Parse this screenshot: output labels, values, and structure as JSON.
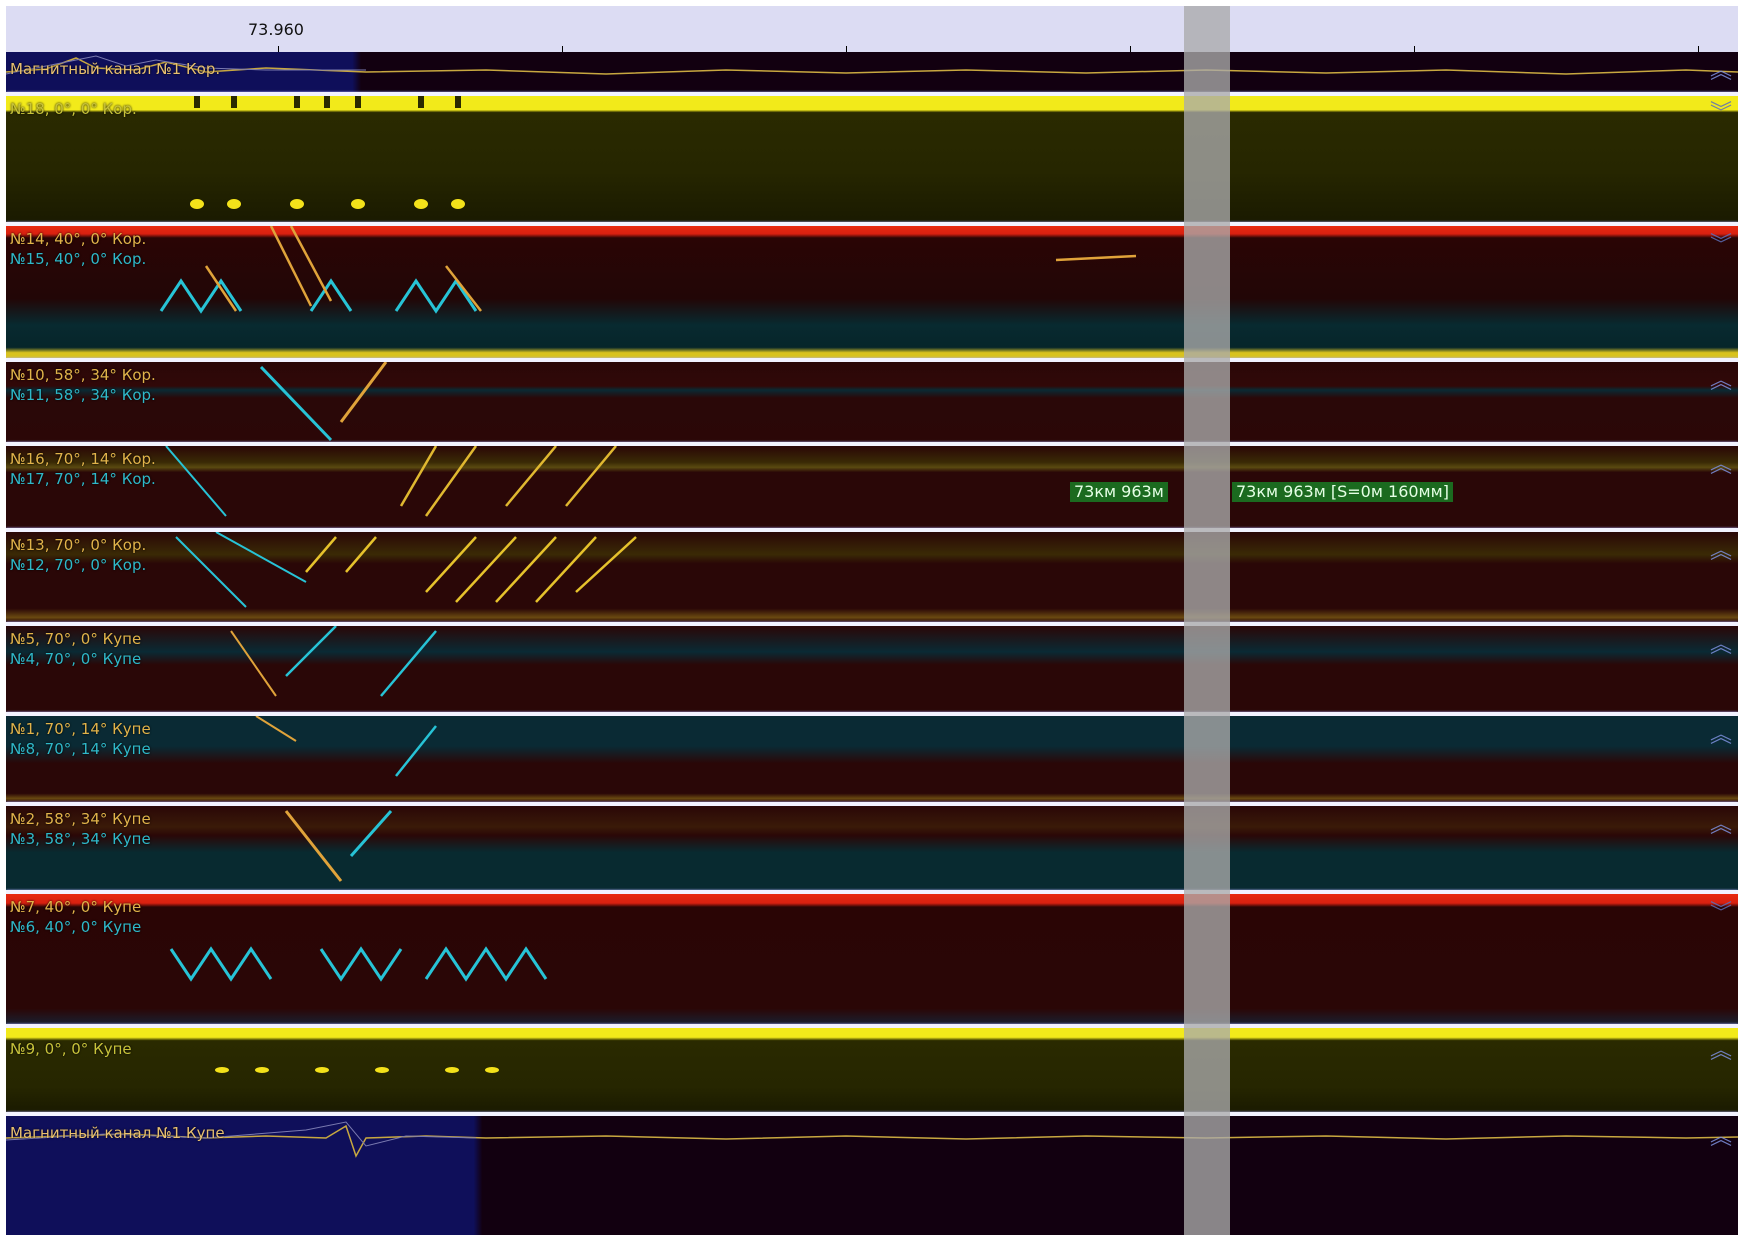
{
  "ruler": {
    "position_label": "73.960"
  },
  "panels": [
    {
      "id": "mag-top",
      "labels": [
        {
          "text": "Магнитный канал №1 Кор.",
          "color": "#e8c070"
        }
      ]
    },
    {
      "id": "ch18",
      "labels": [
        {
          "text": "№18, 0°, 0° Кор.",
          "color": "#c7c23a"
        }
      ]
    },
    {
      "id": "ch14-15",
      "labels": [
        {
          "text": "№14, 40°, 0° Кор.",
          "color": "#e1b34a"
        },
        {
          "text": "№15, 40°, 0° Кор.",
          "color": "#2fb8c9"
        }
      ]
    },
    {
      "id": "ch10-11",
      "labels": [
        {
          "text": "№10, 58°, 34° Кор.",
          "color": "#e1b34a"
        },
        {
          "text": "№11, 58°, 34° Кор.",
          "color": "#2fb8c9"
        }
      ]
    },
    {
      "id": "ch16-17",
      "labels": [
        {
          "text": "№16, 70°, 14° Кор.",
          "color": "#e1b34a"
        },
        {
          "text": "№17, 70°, 14° Кор.",
          "color": "#2fb8c9"
        }
      ]
    },
    {
      "id": "ch13-12",
      "labels": [
        {
          "text": "№13, 70°, 0° Кор.",
          "color": "#e1b34a"
        },
        {
          "text": "№12, 70°, 0° Кор.",
          "color": "#2fb8c9"
        }
      ]
    },
    {
      "id": "ch5-4",
      "labels": [
        {
          "text": "№5, 70°, 0° Купе",
          "color": "#e1b34a"
        },
        {
          "text": "№4, 70°, 0° Купе",
          "color": "#2fb8c9"
        }
      ]
    },
    {
      "id": "ch1-8",
      "labels": [
        {
          "text": "№1, 70°, 14° Купе",
          "color": "#e1b34a"
        },
        {
          "text": "№8, 70°, 14° Купе",
          "color": "#2fb8c9"
        }
      ]
    },
    {
      "id": "ch2-3",
      "labels": [
        {
          "text": "№2, 58°, 34° Купе",
          "color": "#e1b34a"
        },
        {
          "text": "№3, 58°, 34° Купе",
          "color": "#2fb8c9"
        }
      ]
    },
    {
      "id": "ch7-6",
      "labels": [
        {
          "text": "№7, 40°, 0° Купе",
          "color": "#e1b34a"
        },
        {
          "text": "№6, 40°, 0° Купе",
          "color": "#2fb8c9"
        }
      ]
    },
    {
      "id": "ch9",
      "labels": [
        {
          "text": "№9, 0°, 0° Купе",
          "color": "#c7c23a"
        }
      ]
    },
    {
      "id": "mag-bottom",
      "labels": [
        {
          "text": "Магнитный канал №1 Купе",
          "color": "#e8c070"
        }
      ]
    }
  ],
  "cursor": {
    "left_label": "73км 963м",
    "right_label": "73км 963м [S=0м 160мм]"
  },
  "icons": {
    "collapse": "double-chevron-up-icon",
    "expand": "double-chevron-down-icon"
  }
}
